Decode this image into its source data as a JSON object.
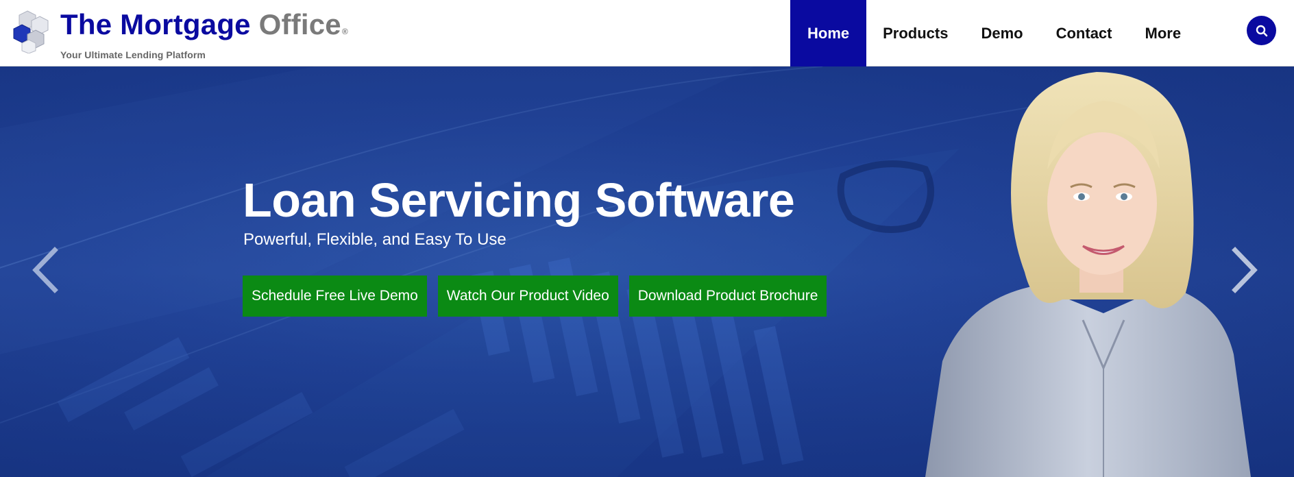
{
  "brand": {
    "name_part1": "The Mortgage",
    "name_part2": "Office",
    "registered": "®",
    "tagline": "Your Ultimate Lending Platform"
  },
  "nav": {
    "items": [
      {
        "label": "Home",
        "active": true
      },
      {
        "label": "Products",
        "active": false
      },
      {
        "label": "Demo",
        "active": false
      },
      {
        "label": "Contact",
        "active": false
      },
      {
        "label": "More",
        "active": false
      }
    ]
  },
  "colors": {
    "brand_blue": "#0a0aa0",
    "cta_green": "#0b8a14",
    "hero_blue": "#23459a"
  },
  "icons": {
    "search": "search-icon",
    "prev": "chevron-left-icon",
    "next": "chevron-right-icon"
  },
  "hero": {
    "title": "Loan Servicing Software",
    "subtitle": "Powerful, Flexible, and Easy To Use",
    "buttons": [
      "Schedule Free Live Demo",
      "Watch Our Product Video",
      "Download Product Brochure"
    ]
  }
}
